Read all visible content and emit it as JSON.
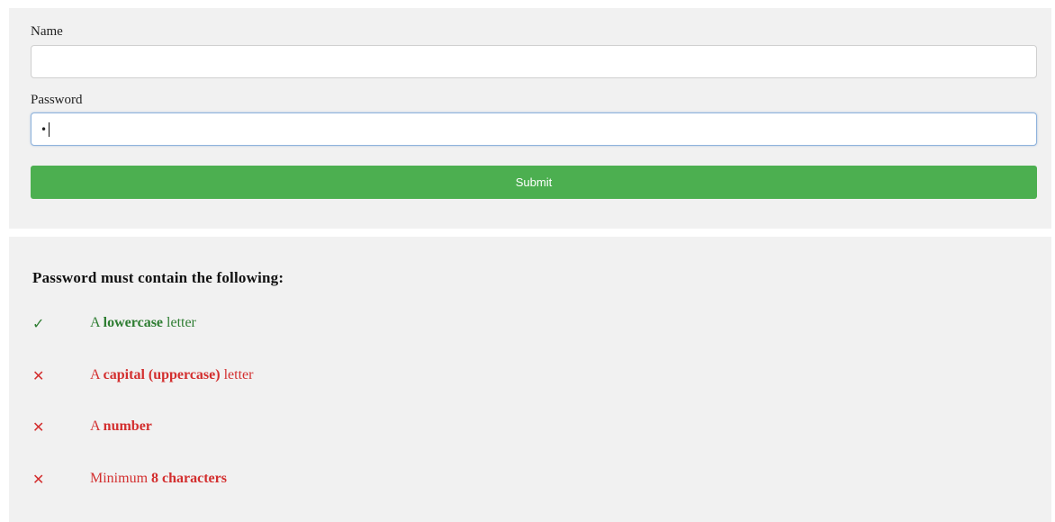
{
  "form": {
    "name_label": "Name",
    "name_value": "",
    "password_label": "Password",
    "password_value": "•",
    "submit_label": "Submit"
  },
  "requirements": {
    "heading": "Password must contain the following:",
    "items": [
      {
        "status": "valid",
        "icon": "✓",
        "icon_name": "check-icon",
        "prefix": "A ",
        "bold": "lowercase",
        "suffix": " letter"
      },
      {
        "status": "invalid",
        "icon": "✕",
        "icon_name": "cross-icon",
        "prefix": "A ",
        "bold": "capital (uppercase)",
        "suffix": " letter"
      },
      {
        "status": "invalid",
        "icon": "✕",
        "icon_name": "cross-icon",
        "prefix": "A ",
        "bold": "number",
        "suffix": ""
      },
      {
        "status": "invalid",
        "icon": "✕",
        "icon_name": "cross-icon",
        "prefix": "Minimum ",
        "bold": "8 characters",
        "suffix": ""
      }
    ]
  },
  "colors": {
    "submit_bg": "#4caf50",
    "valid": "#2e7d32",
    "invalid": "#d32f2f",
    "panel_bg": "#f1f1f1"
  }
}
